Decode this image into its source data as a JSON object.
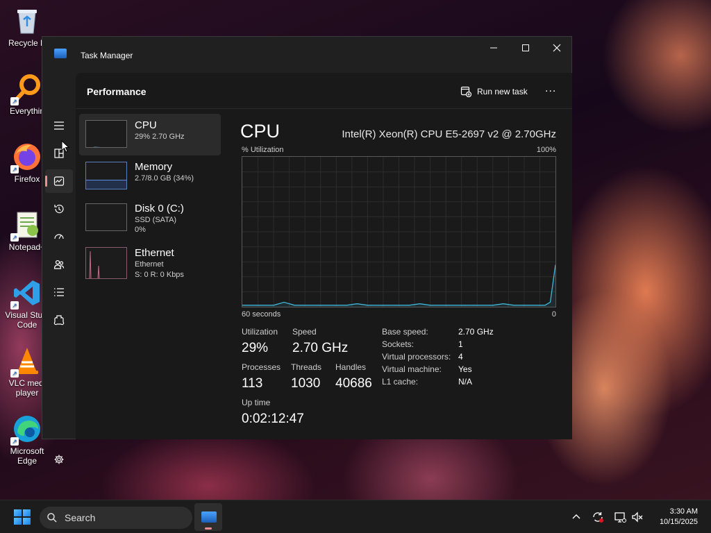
{
  "desktop": {
    "icons": [
      {
        "label": "Recycle B",
        "icon": "recycle-bin-icon"
      },
      {
        "label": "Everythin",
        "icon": "everything-search-icon"
      },
      {
        "label": "Firefox",
        "icon": "firefox-icon"
      },
      {
        "label": "Notepad+",
        "icon": "notepad-plus-plus-icon"
      },
      {
        "label": "Visual Studio Code",
        "line1": "Visual Studi",
        "line2": "Code",
        "icon": "vscode-icon"
      },
      {
        "label": "VLC media player",
        "line1": "VLC medi",
        "line2": "player",
        "icon": "vlc-icon"
      },
      {
        "label": "Microsoft Edge",
        "line1": "Microsoft",
        "line2": "Edge",
        "icon": "edge-icon"
      }
    ]
  },
  "window": {
    "title": "Task Manager",
    "controls": {
      "minimize": "minimize-icon",
      "maximize": "maximize-icon",
      "close": "close-icon"
    }
  },
  "nav": {
    "items": [
      {
        "name": "hamburger-menu",
        "icon": "hamburger-icon"
      },
      {
        "name": "processes",
        "icon": "processes-icon"
      },
      {
        "name": "performance",
        "icon": "performance-icon",
        "active": true
      },
      {
        "name": "app-history",
        "icon": "history-icon"
      },
      {
        "name": "startup-apps",
        "icon": "startup-icon"
      },
      {
        "name": "users",
        "icon": "users-icon"
      },
      {
        "name": "details",
        "icon": "details-icon"
      },
      {
        "name": "services",
        "icon": "services-icon"
      },
      {
        "name": "settings",
        "icon": "gear-icon"
      }
    ]
  },
  "header": {
    "title": "Performance",
    "run_new_task": "Run new task",
    "more": "..."
  },
  "resources": [
    {
      "name": "CPU",
      "sub1": "29%  2.70 GHz",
      "sub2": "",
      "selected": true
    },
    {
      "name": "Memory",
      "sub1": "2.7/8.0 GB (34%)",
      "sub2": ""
    },
    {
      "name": "Disk 0 (C:)",
      "sub1": "SSD (SATA)",
      "sub2": "0%"
    },
    {
      "name": "Ethernet",
      "sub1": "Ethernet",
      "sub2": "S: 0  R: 0 Kbps"
    }
  ],
  "detail": {
    "title": "CPU",
    "model": "Intel(R) Xeon(R) CPU E5-2697 v2 @ 2.70GHz",
    "graph_top_left": "% Utilization",
    "graph_top_right": "100%",
    "graph_bottom_left": "60 seconds",
    "graph_bottom_right": "0",
    "stats": {
      "utilization_label": "Utilization",
      "utilization": "29%",
      "speed_label": "Speed",
      "speed": "2.70 GHz",
      "processes_label": "Processes",
      "processes": "113",
      "threads_label": "Threads",
      "threads": "1030",
      "handles_label": "Handles",
      "handles": "40686",
      "uptime_label": "Up time",
      "uptime": "0:02:12:47"
    },
    "specs": [
      {
        "key": "Base speed:",
        "value": "2.70 GHz"
      },
      {
        "key": "Sockets:",
        "value": "1"
      },
      {
        "key": "Virtual processors:",
        "value": "4"
      },
      {
        "key": "Virtual machine:",
        "value": "Yes"
      },
      {
        "key": "L1 cache:",
        "value": "N/A"
      }
    ]
  },
  "chart_data": {
    "type": "line",
    "title": "",
    "xlabel": "60 seconds",
    "ylabel": "% Utilization",
    "xlim": [
      60,
      0
    ],
    "ylim": [
      0,
      100
    ],
    "x": [
      60,
      58,
      56,
      54,
      52,
      50,
      48,
      46,
      44,
      42,
      40,
      38,
      36,
      34,
      32,
      30,
      28,
      26,
      24,
      22,
      20,
      18,
      16,
      14,
      12,
      10,
      8,
      6,
      4,
      2,
      1,
      0
    ],
    "series": [
      {
        "values": [
          1,
          1,
          1,
          1,
          3,
          1,
          1,
          1,
          1,
          1,
          1,
          2,
          1,
          1,
          1,
          1,
          1,
          2,
          1,
          1,
          1,
          1,
          1,
          1,
          1,
          2,
          1,
          1,
          1,
          1,
          3,
          28
        ]
      }
    ],
    "grid": true
  },
  "taskbar": {
    "search_label": "Search",
    "time": "3:30 AM",
    "date": "10/15/2025"
  },
  "colors": {
    "accent": "#f28e8e",
    "cpu_line": "#3fb6d8",
    "memory_line": "#5a8ee0",
    "ethernet_line": "#c86a8a"
  }
}
